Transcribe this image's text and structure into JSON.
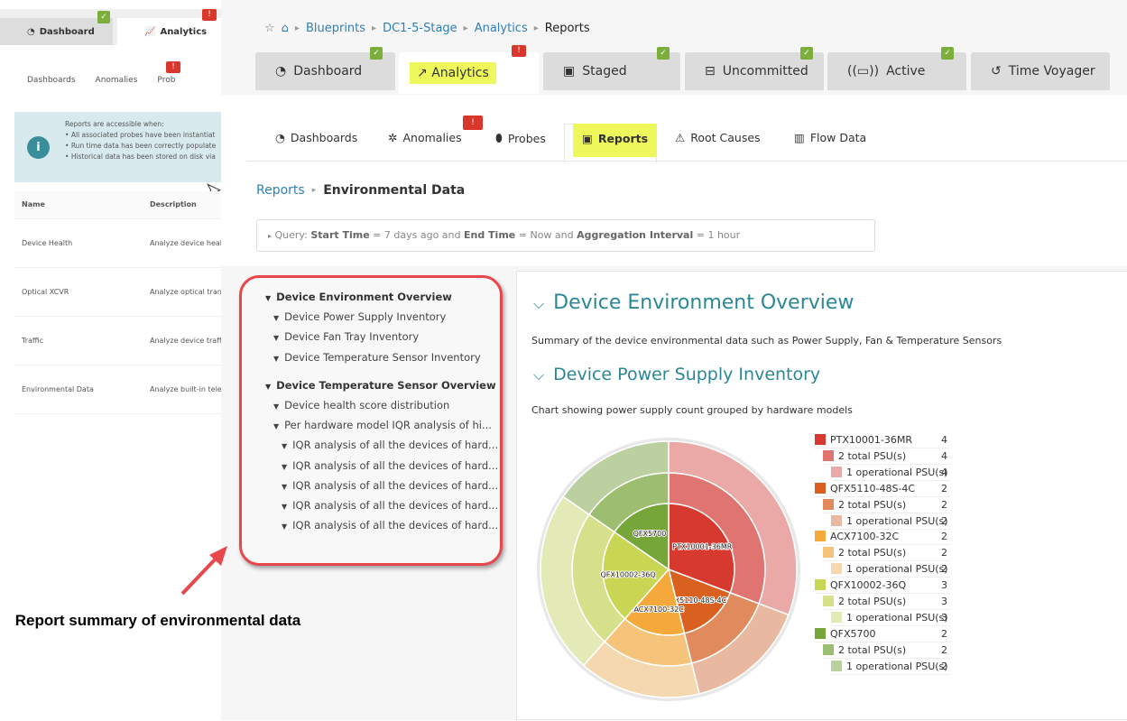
{
  "background": {
    "tabs": [
      "Dashboard",
      "Analytics"
    ],
    "subtabs": [
      "Dashboards",
      "Anomalies",
      "Prob"
    ],
    "info": {
      "heading": "Reports are accessible when:",
      "bullets": [
        "All associated probes have been instantiat",
        "Run time data has been correctly populate",
        "Historical data has been stored on disk via"
      ]
    },
    "table": {
      "headers": [
        "Name",
        "Description"
      ],
      "rows": [
        [
          "Device Health",
          "Analyze device heal"
        ],
        [
          "Optical XCVR",
          "Analyze optical tran"
        ],
        [
          "Traffic",
          "Analyze device traff"
        ],
        [
          "Environmental Data",
          "Analyze built-in tele"
        ]
      ]
    }
  },
  "breadcrumb": [
    "Blueprints",
    "DC1-5-Stage",
    "Analytics",
    "Reports"
  ],
  "tabs": [
    {
      "label": "Dashboard",
      "badge": "ok"
    },
    {
      "label": "Analytics",
      "badge": "warn",
      "active": true
    },
    {
      "label": "Staged",
      "badge": "ok"
    },
    {
      "label": "Uncommitted",
      "badge": "ok"
    },
    {
      "label": "Active",
      "badge": "ok"
    },
    {
      "label": "Time Voyager"
    }
  ],
  "subtabs": [
    {
      "label": "Dashboards"
    },
    {
      "label": "Anomalies",
      "badge": "warn"
    },
    {
      "label": "Probes"
    },
    {
      "label": "Reports",
      "active": true
    },
    {
      "label": "Root Causes"
    },
    {
      "label": "Flow Data"
    }
  ],
  "report_crumb": {
    "parent": "Reports",
    "current": "Environmental Data"
  },
  "query": {
    "prefix": "Query:",
    "k1": "Start Time",
    "v1": "= 7 days ago and",
    "k2": "End Time",
    "v2": "= Now and",
    "k3": "Aggregation Interval",
    "v3": "= 1 hour"
  },
  "tree": [
    {
      "label": "Device Environment Overview",
      "level": 0
    },
    {
      "label": "Device Power Supply Inventory",
      "level": 1
    },
    {
      "label": "Device Fan Tray Inventory",
      "level": 1
    },
    {
      "label": "Device Temperature Sensor Inventory",
      "level": 1
    },
    {
      "label": "Device Temperature Sensor Overview",
      "level": 0
    },
    {
      "label": "Device health score distribution",
      "level": 1
    },
    {
      "label": "Per hardware model IQR analysis of hi...",
      "level": 1
    },
    {
      "label": "IQR analysis of all the devices of hard...",
      "level": 2
    },
    {
      "label": "IQR analysis of all the devices of hard...",
      "level": 2
    },
    {
      "label": "IQR analysis of all the devices of hard...",
      "level": 2
    },
    {
      "label": "IQR analysis of all the devices of hard...",
      "level": 2
    },
    {
      "label": "IQR analysis of all the devices of hard...",
      "level": 2
    }
  ],
  "content": {
    "title1": "Device Environment Overview",
    "desc1": "Summary of the device environmental data such as Power Supply, Fan & Temperature Sensors",
    "title2": "Device Power Supply Inventory",
    "desc2": "Chart showing power supply count grouped by hardware models"
  },
  "chart_data": {
    "type": "sunburst",
    "series": [
      {
        "name": "PTX10001-36MR",
        "value": 4,
        "colors": [
          "#d63a2f",
          "#e07470",
          "#eaa8a6"
        ],
        "children": [
          {
            "name": "2 total PSU(s)",
            "value": 4,
            "children": [
              {
                "name": "1 operational PSU(s)",
                "value": 4
              }
            ]
          }
        ]
      },
      {
        "name": "QFX5110-48S-4C",
        "value": 2,
        "colors": [
          "#d9601f",
          "#e08a5e",
          "#e8b8a0"
        ],
        "children": [
          {
            "name": "2 total PSU(s)",
            "value": 2,
            "children": [
              {
                "name": "1 operational PSU(s)",
                "value": 2
              }
            ]
          }
        ]
      },
      {
        "name": "ACX7100-32C",
        "value": 2,
        "colors": [
          "#f4a93a",
          "#f6c37a",
          "#f5d8b0"
        ],
        "children": [
          {
            "name": "2 total PSU(s)",
            "value": 2,
            "children": [
              {
                "name": "1 operational PSU(s)",
                "value": 2
              }
            ]
          }
        ]
      },
      {
        "name": "QFX10002-36Q",
        "value": 3,
        "colors": [
          "#c8d653",
          "#d6e08a",
          "#e3eab8"
        ],
        "children": [
          {
            "name": "2 total PSU(s)",
            "value": 3,
            "children": [
              {
                "name": "1 operational PSU(s)",
                "value": 3
              }
            ]
          }
        ]
      },
      {
        "name": "QFX5700",
        "value": 2,
        "colors": [
          "#76a53a",
          "#9dbd70",
          "#bccfa0"
        ],
        "children": [
          {
            "name": "2 total PSU(s)",
            "value": 2,
            "children": [
              {
                "name": "1 operational PSU(s)",
                "value": 2
              }
            ]
          }
        ]
      }
    ],
    "legend": "right"
  },
  "annotation": "Report summary of environmental data"
}
